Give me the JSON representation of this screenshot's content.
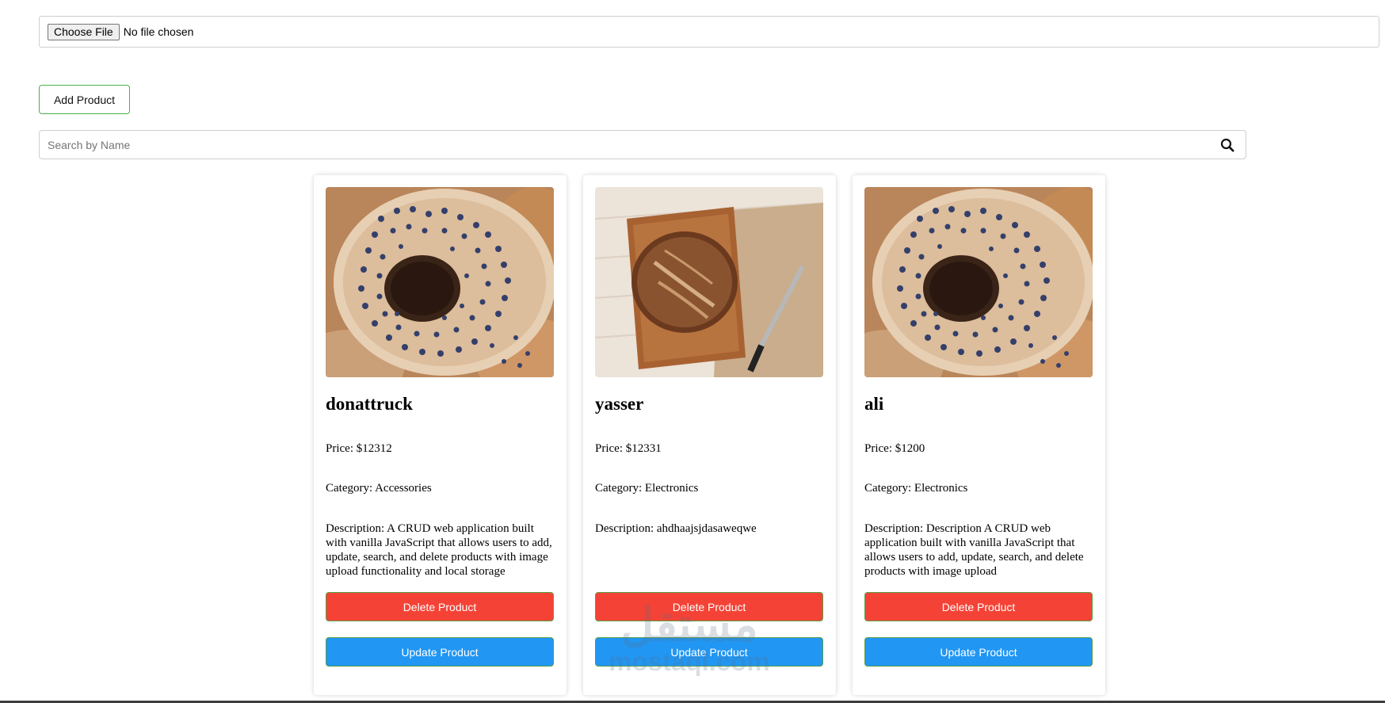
{
  "file_input": {
    "button_label": "Choose File",
    "status": "No file chosen"
  },
  "add_button_label": "Add Product",
  "search": {
    "placeholder": "Search by Name",
    "icon": "search-icon"
  },
  "products": [
    {
      "name": "donattruck",
      "price": "Price: $12312",
      "category": "Category: Accessories",
      "description": "Description: A CRUD web application built with vanilla JavaScript that allows users to add, update, search, and delete products with image upload functionality and local storage",
      "image": "donut-photo",
      "delete_label": "Delete Product",
      "update_label": "Update Product"
    },
    {
      "name": "yasser",
      "price": "Price: $12331",
      "category": "Category: Electronics",
      "description": "Description: ahdhaajsjdasaweqwe",
      "image": "bread-photo",
      "delete_label": "Delete Product",
      "update_label": "Update Product"
    },
    {
      "name": "ali",
      "price": "Price: $1200",
      "category": "Category: Electronics",
      "description": "Description: Description A CRUD web application built with vanilla JavaScript that allows users to add, update, search, and delete products with image upload",
      "image": "donut-photo",
      "delete_label": "Delete Product",
      "update_label": "Update Product"
    }
  ],
  "watermark": {
    "arabic": "مستقل",
    "latin": "mostaql.com"
  },
  "colors": {
    "delete": "#f44336",
    "update": "#2196f3",
    "add_border": "#4caf50"
  }
}
